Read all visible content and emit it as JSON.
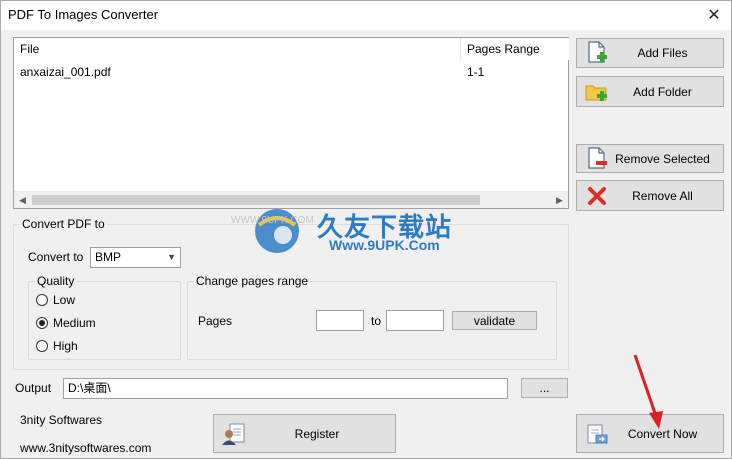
{
  "window": {
    "title": "PDF To Images Converter",
    "close_glyph": "✕"
  },
  "file_list": {
    "columns": [
      "File",
      "Pages Range"
    ],
    "rows": [
      {
        "file": "anxaizai_001.pdf",
        "range": "1-1"
      }
    ]
  },
  "side_buttons": {
    "add_files": "Add Files",
    "add_folder": "Add Folder",
    "remove_selected": "Remove Selected",
    "remove_all": "Remove All"
  },
  "convert": {
    "group_title": "Convert PDF to",
    "convert_to_label": "Convert to",
    "format_selected": "BMP",
    "quality": {
      "title": "Quality",
      "options": [
        "Low",
        "Medium",
        "High"
      ],
      "selected": "Medium"
    },
    "pages_range": {
      "title": "Change pages range",
      "pages_label": "Pages",
      "to_label": "to",
      "from_value": "",
      "to_value": "",
      "validate_label": "validate"
    }
  },
  "output": {
    "label": "Output",
    "path": "D:\\桌面\\",
    "browse_label": "..."
  },
  "footer": {
    "company": "3nity Softwares",
    "website": "www.3nitysoftwares.com",
    "register_label": "Register",
    "convert_now_label": "Convert Now"
  },
  "watermark": {
    "main": "久友下载站",
    "sub": "Www.9UPK.Com",
    "left": "WWW.9UPK.COM"
  },
  "icons": {
    "add_files": "document-add-icon",
    "add_folder": "folder-add-icon",
    "remove_selected": "document-remove-icon",
    "remove_all": "red-x-icon",
    "register": "register-user-icon",
    "convert_now": "convert-document-icon"
  },
  "colors": {
    "accent_green": "#3aa636",
    "remove_red": "#d9302c",
    "watermark_blue": "#1a6fc0"
  }
}
